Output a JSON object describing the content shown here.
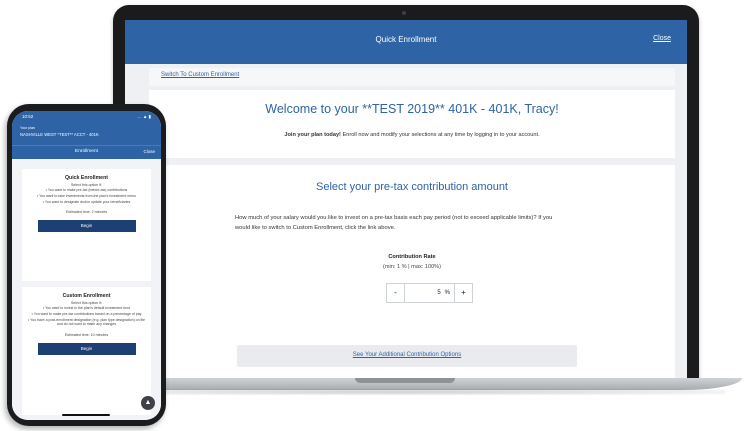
{
  "laptop": {
    "header_title": "Quick Enrollment",
    "close_label": "Close",
    "switch_link": "Switch To Custom Enrollment",
    "welcome_title": "Welcome to your **TEST 2019** 401K - 401K, Tracy!",
    "welcome_bold": "Join your plan today!",
    "welcome_text": " Enroll now and modify your selections at any time by logging in to your account.",
    "section_title": "Select your pre-tax contribution amount",
    "section_desc": "How much of your salary would you like to invest on a pre-tax basis each pay period (not to exceed applicable limits)? If you would like to switch to Custom Enrollment, click the link above.",
    "rate_label": "Contribution Rate",
    "rate_range": "(min: 1 % | max: 100%)",
    "rate_value": "5",
    "rate_unit": "%",
    "minus_label": "-",
    "plus_label": "+",
    "additional_link": "See Your Additional Contribution Options"
  },
  "phone": {
    "status_time": "10:52",
    "status_icons": "… ▲ ▮",
    "plan_line1": "Your plan",
    "plan_line2": "NASHVILLE WEST *TEST** ACCT - 401K",
    "header_title": "Enrollment",
    "close_label": "Close",
    "quick": {
      "title": "Quick Enrollment",
      "sub": "Select this option if:",
      "bullets": [
        "• You want to make pre-tax (before-tax) contributions",
        "• You want to take investments from the plan's investment menu",
        "• You want to designate and/or update your beneficiaries"
      ],
      "time": "Estimated time: 2 minutes",
      "button": "Begin"
    },
    "custom": {
      "title": "Custom Enrollment",
      "sub": "Select this option if:",
      "bullets": [
        "• You want to invest in the plan's default investment fund",
        "• You want to make pre-tax contributions based on a percentage of pay",
        "• You have a post-enrollment designation (e.g. plan type designation) on file and do not want to make any changes"
      ],
      "time": "Estimated time: 10 minutes",
      "button": "Begin"
    },
    "fab_label": "▲"
  }
}
